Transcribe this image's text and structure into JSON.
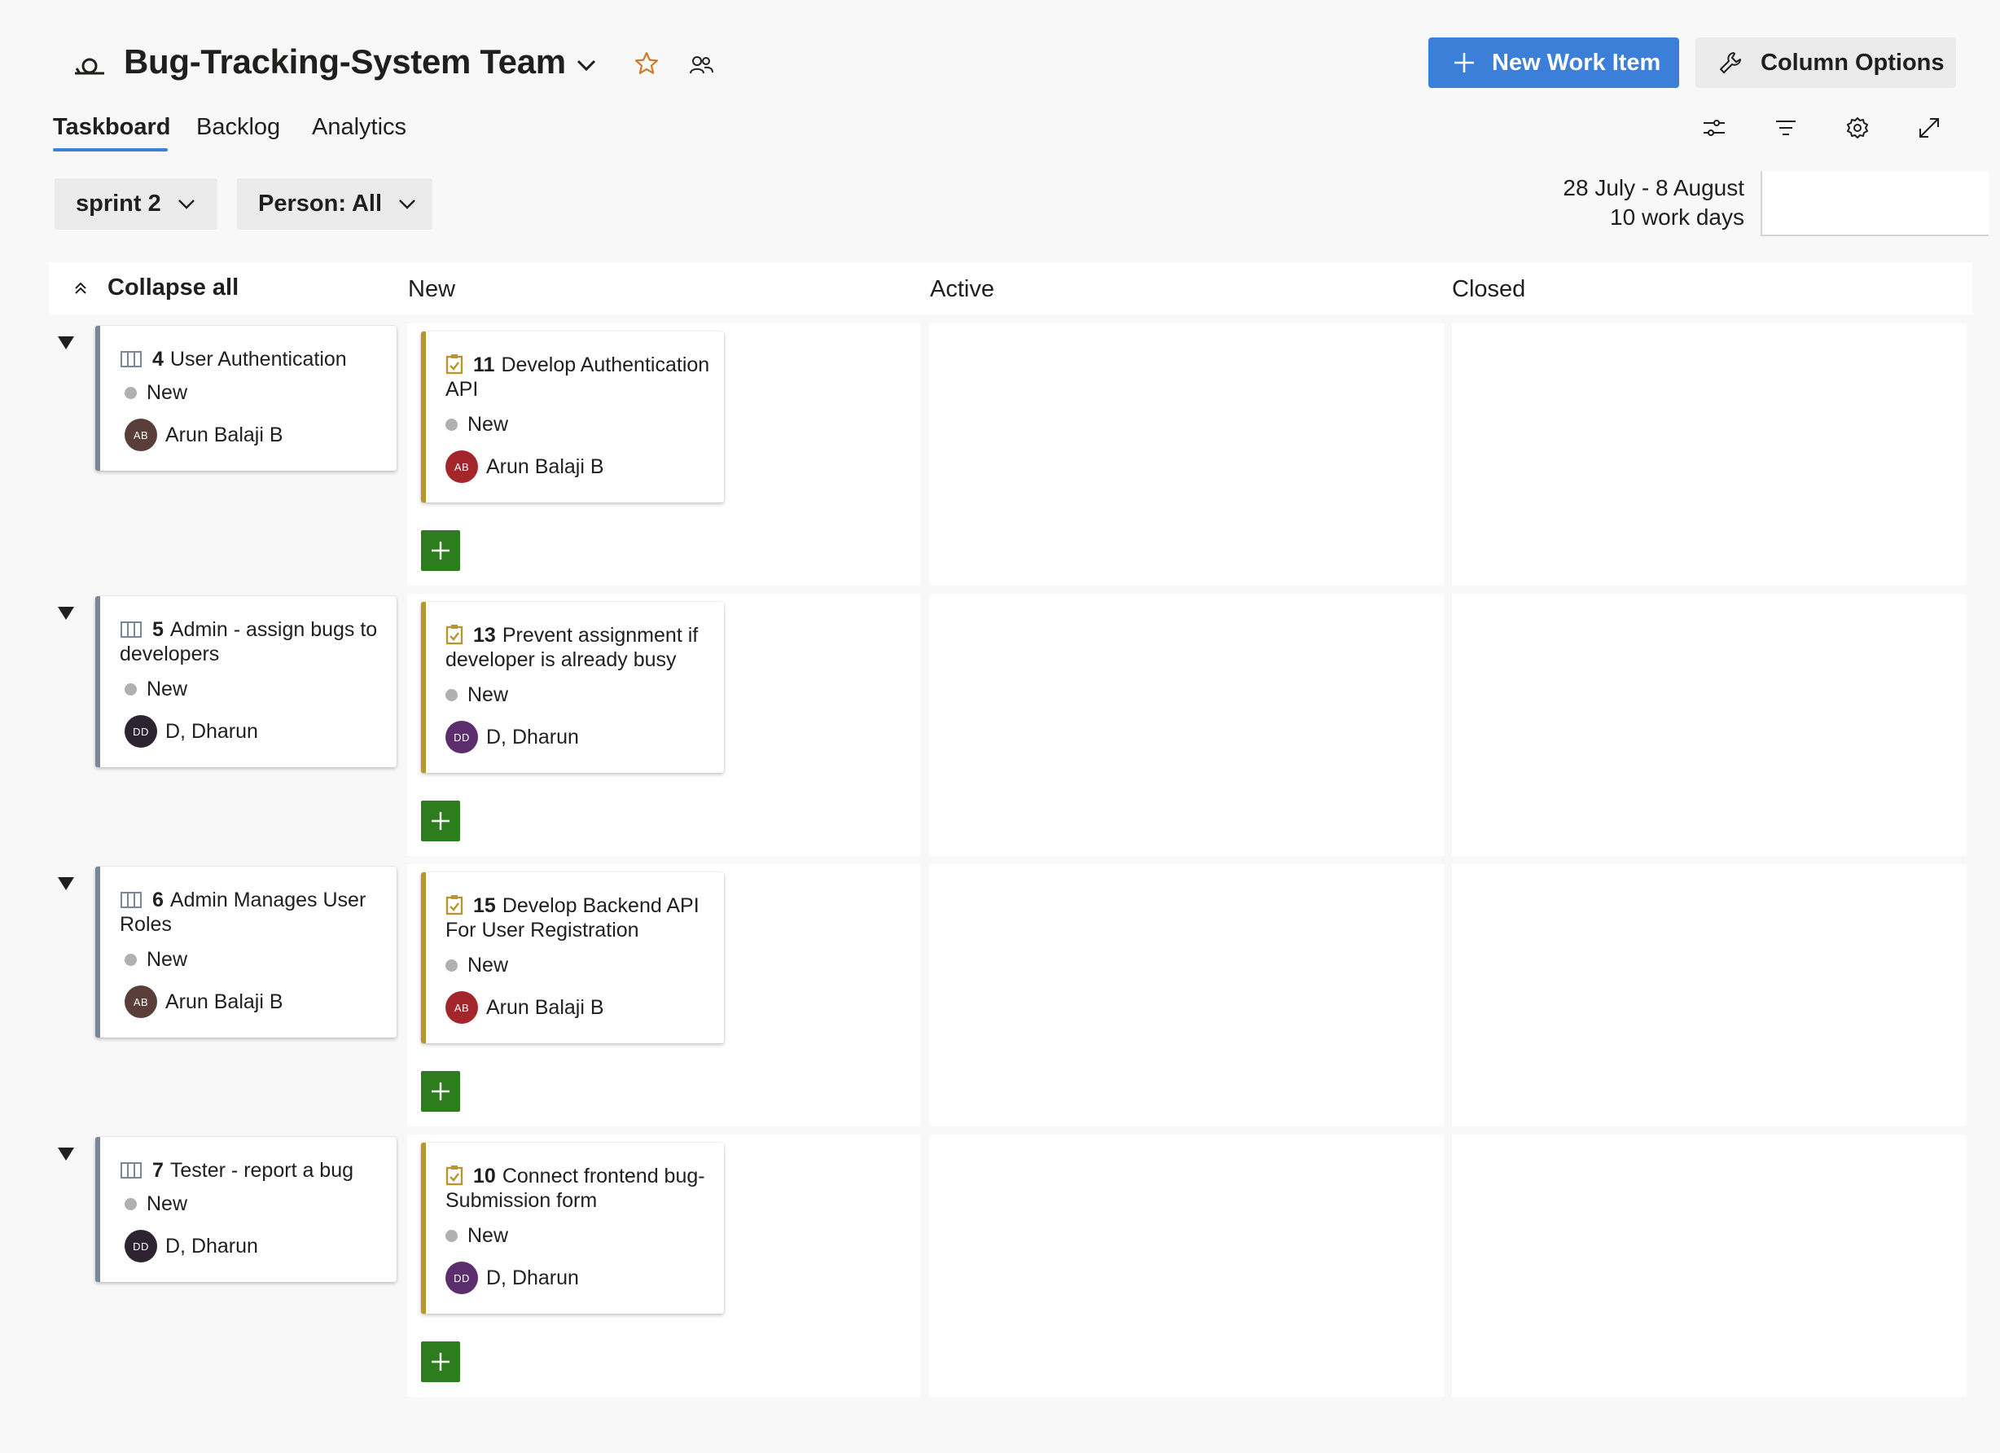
{
  "header": {
    "team_title": "Bug-Tracking-System Team",
    "new_work_item": "New Work Item",
    "column_options": "Column Options"
  },
  "tabs": [
    {
      "label": "Taskboard",
      "active": true
    },
    {
      "label": "Backlog",
      "active": false
    },
    {
      "label": "Analytics",
      "active": false
    }
  ],
  "toolbar_icons": [
    "view-options-icon",
    "filter-icon",
    "settings-icon",
    "fullscreen-icon"
  ],
  "filters": {
    "sprint": "sprint 2",
    "person": "Person: All"
  },
  "sprint_info": {
    "dates": "28 July - 8 August",
    "work_days": "10 work days"
  },
  "board": {
    "collapse_all": "Collapse all",
    "columns": [
      "New",
      "Active",
      "Closed"
    ],
    "rows": [
      {
        "story": {
          "id": "4",
          "title": "User Authentication",
          "state": "New",
          "assignee": "Arun Balaji B",
          "initials": "AB",
          "avatar_color": "#5a3e3a"
        },
        "task": {
          "id": "11",
          "title": "Develop Authentication API",
          "state": "New",
          "assignee": "Arun Balaji B",
          "initials": "AB",
          "avatar_color": "#a4262c"
        }
      },
      {
        "story": {
          "id": "5",
          "title": "Admin - assign bugs to developers",
          "state": "New",
          "assignee": "D, Dharun",
          "initials": "DD",
          "avatar_color": "#2e2330"
        },
        "task": {
          "id": "13",
          "title": "Prevent assignment if developer is already busy",
          "state": "New",
          "assignee": "D, Dharun",
          "initials": "DD",
          "avatar_color": "#5c2e6e"
        }
      },
      {
        "story": {
          "id": "6",
          "title": "Admin Manages User Roles",
          "state": "New",
          "assignee": "Arun Balaji B",
          "initials": "AB",
          "avatar_color": "#5a3e3a"
        },
        "task": {
          "id": "15",
          "title": "Develop Backend API For User Registration",
          "state": "New",
          "assignee": "Arun Balaji B",
          "initials": "AB",
          "avatar_color": "#a4262c"
        }
      },
      {
        "story": {
          "id": "7",
          "title": "Tester - report a bug",
          "state": "New",
          "assignee": "D, Dharun",
          "initials": "DD",
          "avatar_color": "#2e2330"
        },
        "task": {
          "id": "10",
          "title": "Connect frontend bug-Submission form",
          "state": "New",
          "assignee": "D, Dharun",
          "initials": "DD",
          "avatar_color": "#5c2e6e"
        }
      }
    ]
  },
  "colors": {
    "accent": "#3b7fd9",
    "add_button": "#2d7d1e",
    "story_bar": "#7a8799",
    "task_bar": "#b8962e",
    "favorite_star": "#d07a2a"
  }
}
